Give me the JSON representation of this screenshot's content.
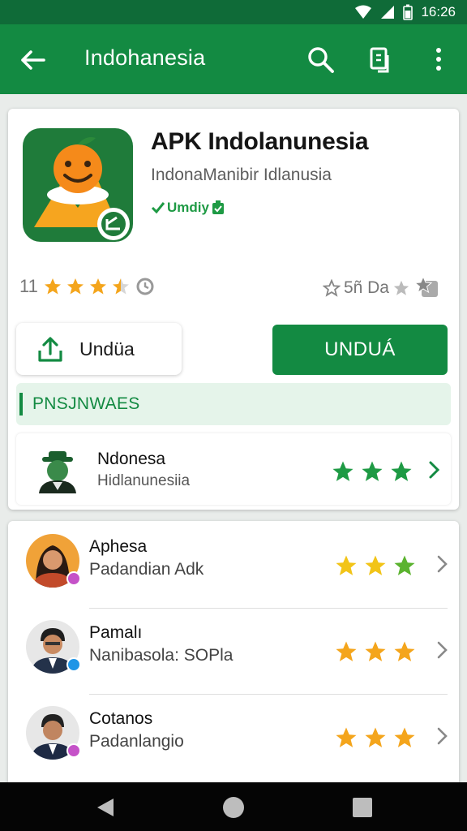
{
  "status_bar": {
    "time": "16:26"
  },
  "app_bar": {
    "title": "Indohanesia"
  },
  "app": {
    "name": "APK Indolanunesia",
    "developer": "IndonaManibir Idlanusia",
    "verified_label": "Umdiy"
  },
  "rating": {
    "count_left": "11",
    "stars": 3.5,
    "right_text": "5ñ Da"
  },
  "buttons": {
    "share_label": "Undüa",
    "install_label": "UNDUÁ"
  },
  "section": {
    "title": "PNSJNWAES"
  },
  "featured": {
    "name": "Ndonesa",
    "subtitle": "Hidlanunesiia",
    "stars": 3
  },
  "reviews": [
    {
      "name": "Aphesa",
      "subtitle": "Padandian Adk",
      "stars": 3,
      "badge_color": "#c552c8"
    },
    {
      "name": "Pamalı",
      "subtitle": "Nanibasola: SOPla",
      "stars": 3,
      "badge_color": "#1f95e6"
    },
    {
      "name": "Cotanos",
      "subtitle": "Padanlangio",
      "stars": 3,
      "badge_color": "#c552c8"
    }
  ],
  "colors": {
    "primary": "#138a42",
    "status": "#0f6b38",
    "star_gold": "#f4a51c",
    "star_green": "#1e9a44"
  },
  "icons": [
    "back-arrow-icon",
    "search-icon",
    "tile-icon",
    "more-vert-icon",
    "share-upload-icon",
    "chevron-right-icon",
    "nav-back-icon",
    "nav-home-icon",
    "nav-recents-icon"
  ]
}
